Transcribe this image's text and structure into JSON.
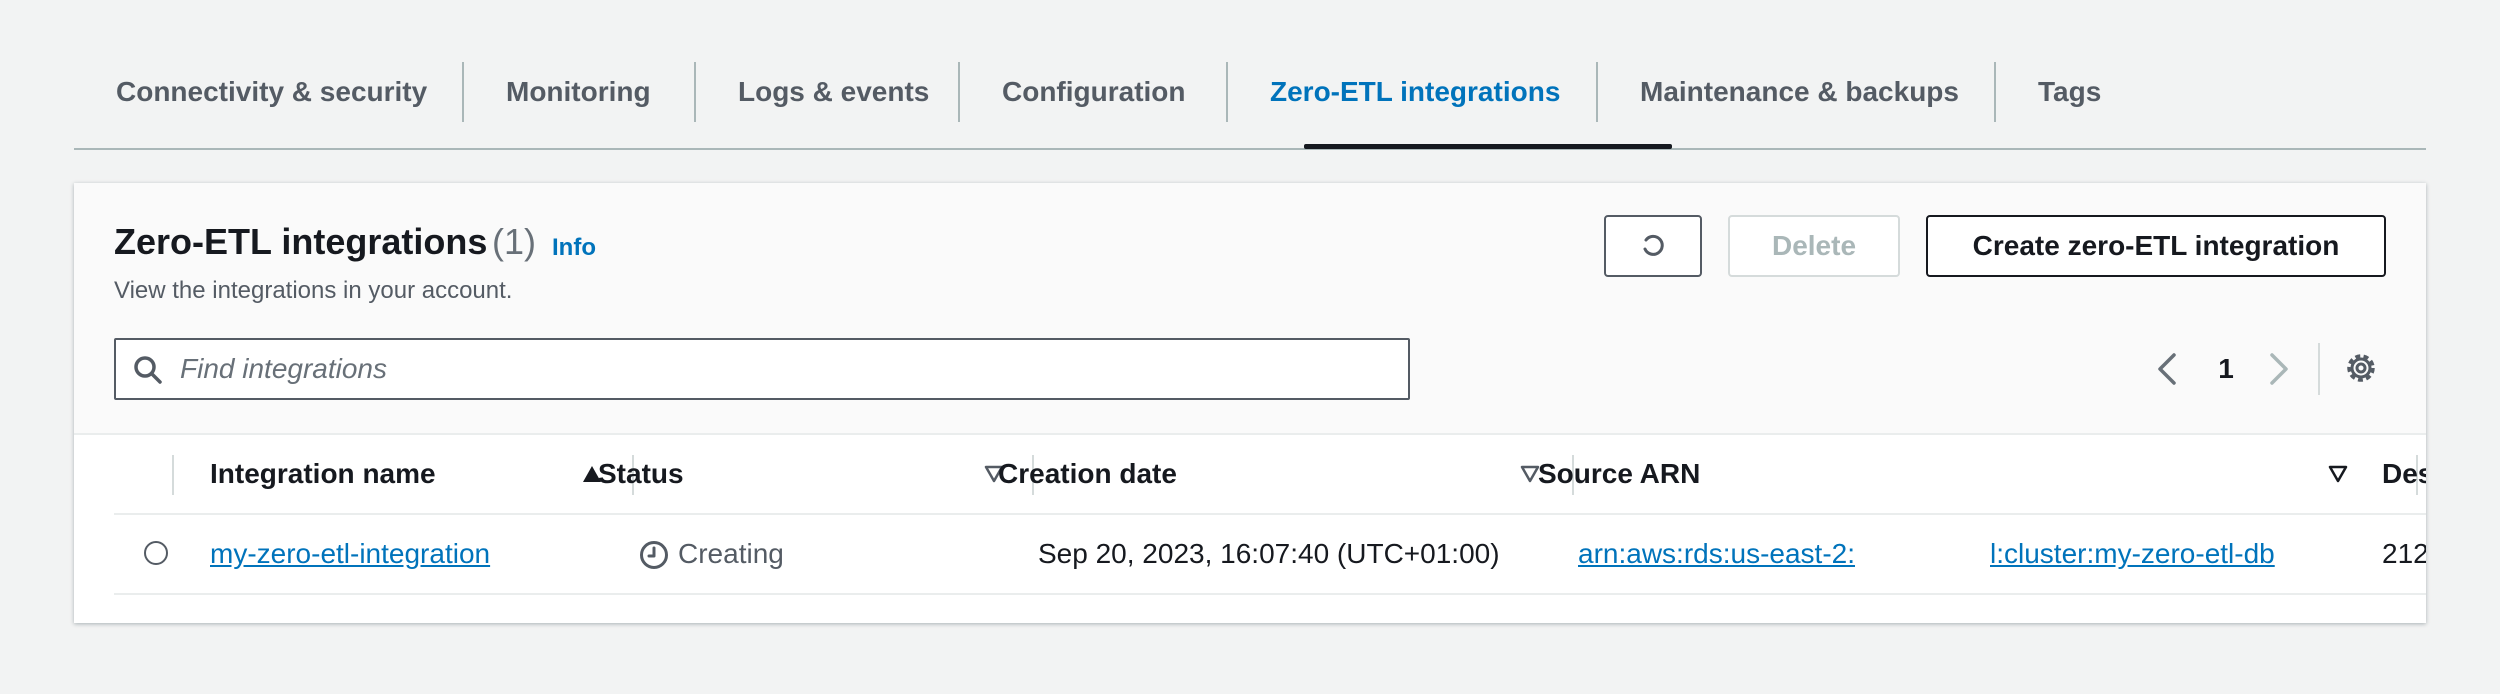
{
  "tabs": [
    {
      "label": "Connectivity & security"
    },
    {
      "label": "Monitoring"
    },
    {
      "label": "Logs & events"
    },
    {
      "label": "Configuration"
    },
    {
      "label": "Zero-ETL integrations",
      "active": true
    },
    {
      "label": "Maintenance & backups"
    },
    {
      "label": "Tags"
    }
  ],
  "panel": {
    "title": "Zero-ETL integrations",
    "count": "(1)",
    "info_label": "Info",
    "description": "View the integrations in your account.",
    "delete_label": "Delete",
    "create_label": "Create zero-ETL integration",
    "refresh_icon": "refresh-icon",
    "delete_disabled": true
  },
  "search": {
    "placeholder": "Find integrations",
    "value": ""
  },
  "pagination": {
    "current_page": "1"
  },
  "table": {
    "columns": [
      {
        "label": "Integration name",
        "sort": "ascending"
      },
      {
        "label": "Status",
        "sort": "none"
      },
      {
        "label": "Creation date",
        "sort": "none"
      },
      {
        "label": "Source ARN",
        "sort": "none"
      },
      {
        "label": "Des"
      }
    ],
    "rows": [
      {
        "name": "my-zero-etl-integration",
        "status": "Creating",
        "creation_date": "Sep 20, 2023, 16:07:40 (UTC+01:00)",
        "source_arn_start": "arn:aws:rds:us-east-2:",
        "source_arn_end": "l:cluster:my-zero-etl-db",
        "destination": "212"
      }
    ]
  },
  "colors": {
    "accent": "#0073bb",
    "text": "#16191f",
    "muted": "#545b64",
    "page_bg": "#f2f3f3"
  }
}
